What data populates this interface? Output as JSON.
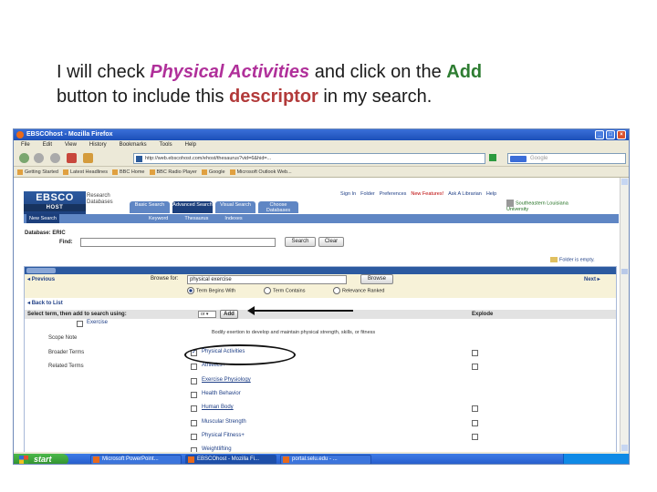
{
  "caption": {
    "line1_pre": "I will check ",
    "line1_term": "Physical Activities",
    "line1_mid": " and click on the ",
    "line1_add": "Add",
    "line2_pre": "button to include this ",
    "line2_word": "descriptor",
    "line2_post": " in my search."
  },
  "browser": {
    "title": "EBSCOhost - Mozilla Firefox",
    "menu": [
      "File",
      "Edit",
      "View",
      "History",
      "Bookmarks",
      "Tools",
      "Help"
    ],
    "url": "http://web.ebscohost.com/ehost/thesaurus?vid=6&hid=...",
    "search_placeholder": "Google",
    "bookmarks": [
      "Getting Started",
      "Latest Headlines",
      "BBC Home",
      "BBC Radio Player",
      "Google",
      "Microsoft Outlook Web..."
    ]
  },
  "ebsco": {
    "logo": "EBSCO",
    "logo_sub": "HOST",
    "research_db": "Research Databases",
    "tabs": [
      "Basic Search",
      "Advanced Search",
      "Visual Search",
      "Choose Databases"
    ],
    "toplinks": [
      "Sign In",
      "Folder",
      "Preferences",
      "New Features!",
      "Ask A Librarian",
      "Help"
    ],
    "library": "Southeastern Louisiana University",
    "nav": [
      "New Search",
      "Keyword",
      "Thesaurus",
      "Indexes"
    ],
    "db_label": "Database: ERIC",
    "find_label": "Find:",
    "search_btn": "Search",
    "clear_btn": "Clear",
    "folder_empty": "Folder is empty."
  },
  "thesaurus": {
    "previous": "Previous",
    "next": "Next",
    "browse_label": "Browse for:",
    "browse_value": "physical exercise",
    "browse_btn": "Browse",
    "radios": [
      "Term Begins With",
      "Term Contains",
      "Relevance Ranked"
    ],
    "back": "Back to List",
    "select_prompt": "Select term, then add to search using:",
    "operator": "or",
    "add_btn": "Add",
    "explode_label": "Explode",
    "main_term": "Exercise",
    "scope_label": "Scope Note",
    "scope_text": "Bodily exertion to develop and maintain physical strength, skills, or fitness",
    "broader_label": "Broader Terms",
    "related_label": "Related Terms",
    "terms": [
      {
        "label": "Physical Activities",
        "checked": true
      },
      {
        "label": "Athletics+",
        "checked": false
      },
      {
        "label": "Exercise Physiology",
        "checked": false
      },
      {
        "label": "Health Behavior",
        "checked": false
      },
      {
        "label": "Human Body",
        "checked": false
      },
      {
        "label": "Muscular Strength",
        "checked": false
      },
      {
        "label": "Physical Fitness+",
        "checked": false
      },
      {
        "label": "Weightlifting",
        "checked": false
      }
    ]
  },
  "taskbar": {
    "start": "start",
    "tasks": [
      "Microsoft PowerPoint...",
      "EBSCOhost - Mozilla Fi...",
      "portal.selu.edu - ..."
    ]
  }
}
